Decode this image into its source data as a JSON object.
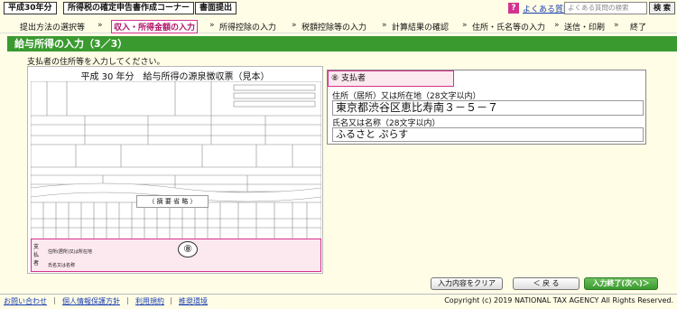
{
  "header": {
    "year_button": "平成30年分",
    "corner_button": "所得税の確定申告書作成コーナー",
    "submit_button": "書面提出",
    "faq_link": "よくある質問",
    "search_placeholder": "よくある質問の検索",
    "search_button": "検 索"
  },
  "steps": [
    {
      "label": "提出方法の選択等"
    },
    {
      "label": "収入・所得金額の入力"
    },
    {
      "label": "所得控除の入力"
    },
    {
      "label": "税額控除等の入力"
    },
    {
      "label": "計算結果の確認"
    },
    {
      "label": "住所・氏名等の入力"
    },
    {
      "label": "送信・印刷"
    },
    {
      "label": "終了"
    }
  ],
  "page": {
    "title": "給与所得の入力（3／3）",
    "instruction": "支払者の住所等を入力してください。"
  },
  "form_image": {
    "title": "平成 30 年分　給与所得の源泉徴収票（見本）",
    "omitted_label": "（ 摘 要 省 略 ）",
    "payer_marker": "⑧",
    "payer_labels": [
      "住所(居所)又は所在地",
      "氏名又は名称"
    ],
    "side_labels": [
      "支",
      "払",
      "者"
    ]
  },
  "panel": {
    "marker": "⑧",
    "heading": "支払者",
    "address_label": "住所（居所）又は所在地（28文字以内）",
    "address_value": "東京都渋谷区恵比寿南３－５－７",
    "name_label": "氏名又は名称（28文字以内）",
    "name_value": "ふるさと ぷらす"
  },
  "buttons": {
    "clear": "入力内容をクリア",
    "back": "＜ 戻 る",
    "finish": "入力終了(次へ)＞"
  },
  "footer": {
    "links": [
      "お問い合わせ",
      "個人情報保護方針",
      "利用規約",
      "推奨環境"
    ],
    "copyright": "Copyright (c) 2019 NATIONAL TAX AGENCY All Rights Reserved."
  },
  "colors": {
    "accent_green": "#3a9a2f",
    "accent_pink": "#d3338f",
    "background": "#fffde6"
  }
}
